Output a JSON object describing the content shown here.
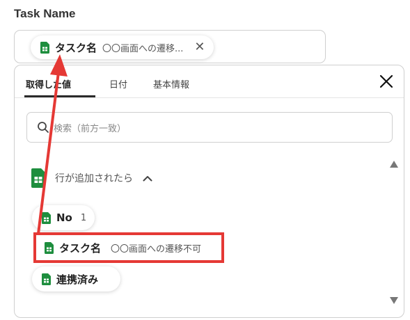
{
  "field": {
    "label": "Task Name",
    "chip": {
      "name": "タスク名",
      "value": "〇〇画面への遷移..."
    }
  },
  "panel": {
    "tabs": [
      {
        "label": "取得した値",
        "active": true
      },
      {
        "label": "日付",
        "active": false
      },
      {
        "label": "基本情報",
        "active": false
      }
    ],
    "search_placeholder": "検索（前方一致）",
    "trigger": {
      "label": "行が追加されたら",
      "expanded": true
    },
    "items": [
      {
        "name": "No",
        "value": "1"
      },
      {
        "name": "タスク名",
        "value": "〇〇画面への遷移不可"
      },
      {
        "name": "連携済み",
        "value": ""
      }
    ]
  },
  "colors": {
    "sheets_green": "#1e8e3e",
    "highlight_red": "#e53935",
    "tab_active": "#2a2a2a"
  }
}
